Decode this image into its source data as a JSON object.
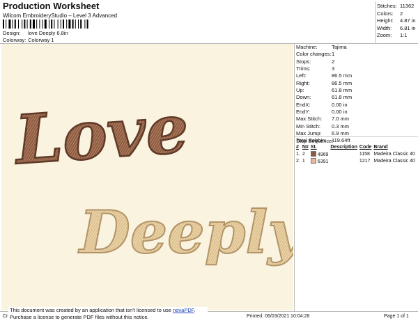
{
  "header": {
    "title": "Production Worksheet",
    "subtitle": "Wilcom EmbroideryStudio – Level 3 Advanced",
    "design_label": "Design:",
    "design_value": "love Deeply 6.8in",
    "colorway_label": "Colorway:",
    "colorway_value": "Colorway 1"
  },
  "stats": [
    {
      "label": "Stitches:",
      "value": "11362"
    },
    {
      "label": "Colors:",
      "value": "2"
    },
    {
      "label": "Height:",
      "value": "4.87 in"
    },
    {
      "label": "Width:",
      "value": "6.81 in"
    },
    {
      "label": "Zoom:",
      "value": "1:1"
    }
  ],
  "machine_info": [
    {
      "label": "Machine:",
      "value": "Tajima"
    },
    {
      "label": "Color changes:",
      "value": "1"
    },
    {
      "label": "Stops:",
      "value": "2"
    },
    {
      "label": "Trims:",
      "value": "3"
    },
    {
      "label": "Left:",
      "value": "86.5 mm"
    },
    {
      "label": "Right:",
      "value": "86.5 mm"
    },
    {
      "label": "Up:",
      "value": "61.8 mm"
    },
    {
      "label": "Down:",
      "value": "61.8 mm"
    },
    {
      "label": "EndX:",
      "value": "0.00 in"
    },
    {
      "label": "EndY:",
      "value": "0.00 in"
    },
    {
      "label": "Max Stitch:",
      "value": "7.0 mm"
    },
    {
      "label": "Min Stitch:",
      "value": "0.3 mm"
    },
    {
      "label": "Max Jump:",
      "value": "6.9 mm"
    },
    {
      "label": "Total Bobbin:",
      "value": "119.64ft"
    }
  ],
  "stop_sequence": {
    "title": "Stop Sequence:",
    "headers": {
      "num": "#",
      "n": "N#",
      "st": "St.",
      "desc": "Description",
      "code": "Code",
      "brand": "Brand"
    },
    "rows": [
      {
        "num": "1.",
        "n": "2",
        "color": "#8a5a42",
        "st": "4969",
        "desc": "",
        "code": "1158",
        "brand": "Madeira Classic 40"
      },
      {
        "num": "2.",
        "n": "1",
        "color": "#e8b898",
        "st": "6391",
        "desc": "",
        "code": "1217",
        "brand": "Madeira Classic 40"
      }
    ]
  },
  "design": {
    "word1": "Love",
    "word2": "Deeply",
    "background": "#f9f3e0",
    "color1": "#8a5a42",
    "color2": "#e2c79a"
  },
  "footer": {
    "left": "Cr",
    "printed": "Printed: 06/03/2021 10:04:28",
    "page": "Page 1 of 1"
  },
  "notice": {
    "line1": "This document was created by an application that isn't licensed to use",
    "link": "novaPDF",
    "line1_end": ".",
    "line2": "Purchase a license to generate PDF files without this notice."
  }
}
